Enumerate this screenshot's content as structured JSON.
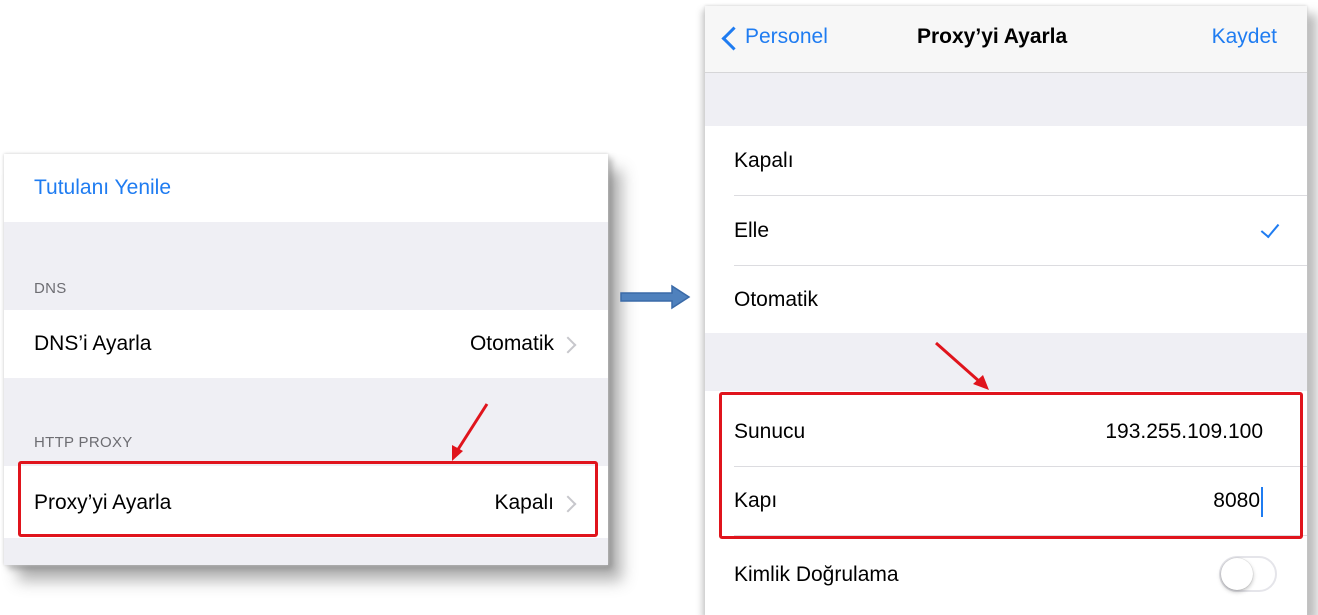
{
  "left_screen": {
    "refresh_lease_label": "Tutulanı Yenile",
    "dns_section_header": "DNS",
    "dns_row": {
      "label": "DNS’i Ayarla",
      "value": "Otomatik"
    },
    "proxy_section_header": "HTTP PROXY",
    "proxy_row": {
      "label": "Proxy’yi Ayarla",
      "value": "Kapalı"
    }
  },
  "right_screen": {
    "nav": {
      "back_label": "Personel",
      "title": "Proxy’yi Ayarla",
      "save_label": "Kaydet"
    },
    "mode_options": [
      {
        "label": "Kapalı",
        "selected": false
      },
      {
        "label": "Elle",
        "selected": true
      },
      {
        "label": "Otomatik",
        "selected": false
      }
    ],
    "server_row": {
      "label": "Sunucu",
      "value": "193.255.109.100"
    },
    "port_row": {
      "label": "Kapı",
      "value": "8080"
    },
    "auth_row": {
      "label": "Kimlik Doğrulama",
      "enabled": false
    }
  },
  "colors": {
    "accent": "#1f7cf1",
    "highlight_red": "#e0141c",
    "arrow_blue": "#4f81bd",
    "group_background": "#efeff4"
  }
}
